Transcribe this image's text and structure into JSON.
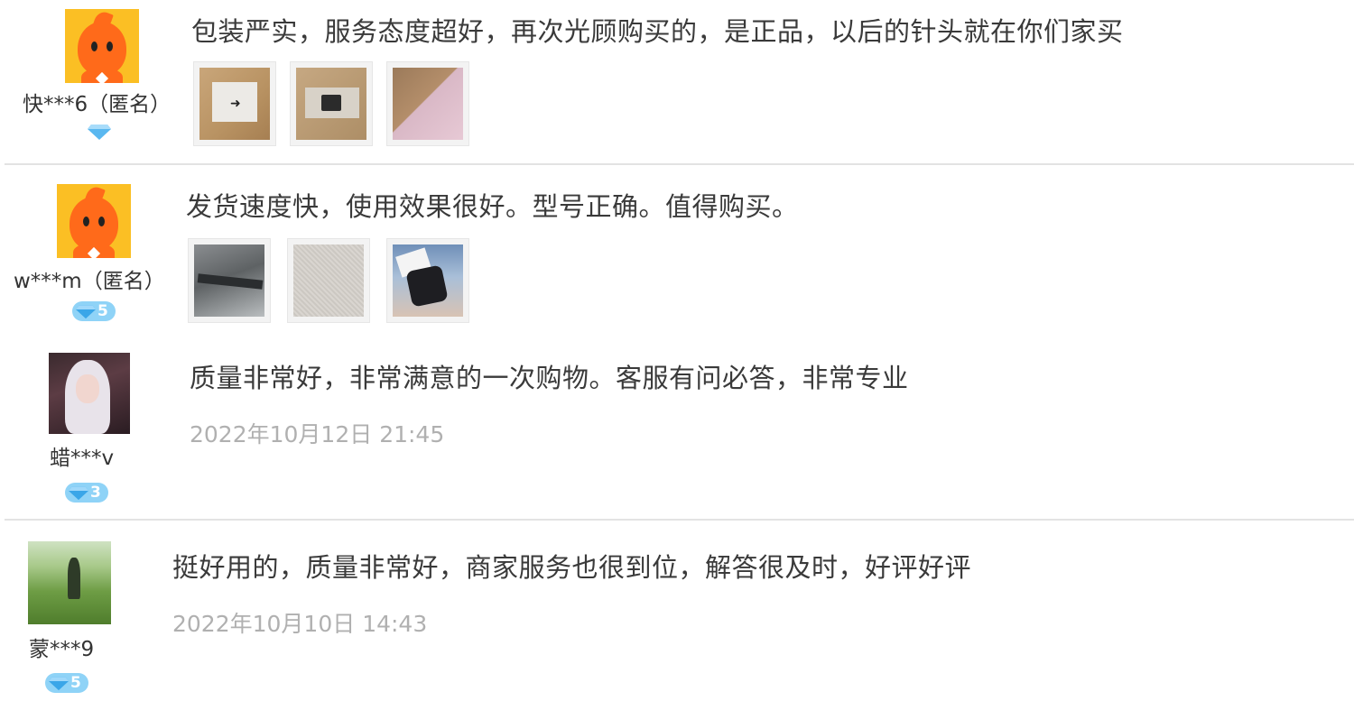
{
  "reviews": [
    {
      "username": "快***6（匿名）",
      "text": "包装严实，服务态度超好，再次光顾购买的，是正品，以后的针头就在你们家买",
      "thumbnails": [
        "product-photo",
        "product-photo",
        "product-photo"
      ]
    },
    {
      "username": "w***m（匿名）",
      "badge_level": "5",
      "text": "发货速度快，使用效果很好。型号正确。值得购买。",
      "thumbnails": [
        "product-photo",
        "product-photo",
        "product-photo"
      ]
    },
    {
      "username": "蜡***v",
      "badge_level": "3",
      "text": "质量非常好，非常满意的一次购物。客服有问必答，非常专业",
      "timestamp": "2022年10月12日 21:45"
    },
    {
      "username": "蒙***9",
      "badge_level": "5",
      "text": "挺好用的，质量非常好，商家服务也很到位，解答很及时，好评好评",
      "timestamp": "2022年10月10日 14:43"
    }
  ],
  "colors": {
    "badge_blue": "#8fd3f7",
    "avatar_orange": "#ff6a1a",
    "timestamp_gray": "#b0b0b0"
  },
  "icons": {
    "badge": "diamond-icon"
  }
}
